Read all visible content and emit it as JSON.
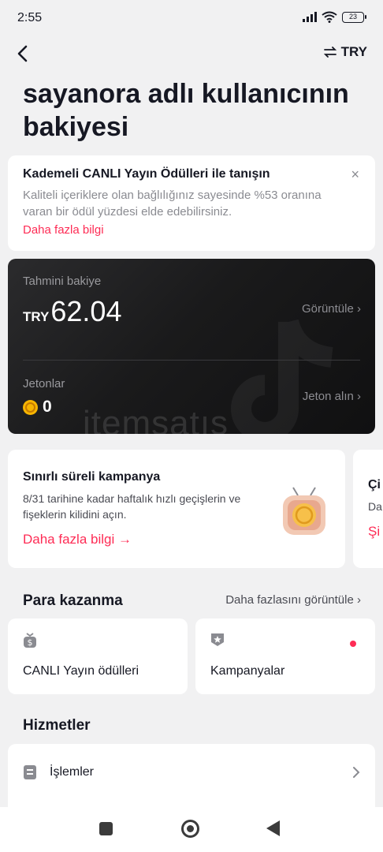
{
  "status_bar": {
    "time": "2:55",
    "battery": "23"
  },
  "nav": {
    "currency": "TRY"
  },
  "page_title": "sayanora adlı kullanıcının bakiyesi",
  "promo": {
    "title": "Kademeli CANLI Yayın Ödülleri ile tanışın",
    "description": "Kaliteli içeriklere olan bağlılığınız sayesinde %53 oranına varan bir ödül yüzdesi elde edebilirsiniz.",
    "link": "Daha fazla bilgi",
    "close": "×"
  },
  "balance": {
    "estimated_label": "Tahmini bakiye",
    "currency": "TRY",
    "amount": "62.04",
    "view_link": "Görüntüle ›",
    "coins_label": "Jetonlar",
    "coins": "0",
    "buy_coins_link": "Jeton alın ›",
    "watermark": "itemsatış"
  },
  "campaign": {
    "title": "Sınırlı süreli kampanya",
    "description": "8/31 tarihine kadar haftalık hızlı geçişlerin ve fişeklerin kilidini açın.",
    "link": "Daha fazla bilgi →"
  },
  "campaign_peek": {
    "title": "Çi",
    "description": "Da",
    "link": "Şi"
  },
  "earn": {
    "title": "Para kazanma",
    "see_more": "Daha fazlasını görüntüle ›",
    "tiles": [
      {
        "label": "CANLI Yayın ödülleri",
        "icon": "money-bag-icon"
      },
      {
        "label": "Kampanyalar",
        "icon": "star-badge-icon"
      }
    ]
  },
  "services": {
    "title": "Hizmetler",
    "items": [
      {
        "label": "İşlemler",
        "icon": "document-icon"
      }
    ]
  },
  "colors": {
    "accent": "#fe2c55",
    "background": "#f1f1f2",
    "card_dark": "#1a1a1b",
    "coin": "#f7b500"
  }
}
